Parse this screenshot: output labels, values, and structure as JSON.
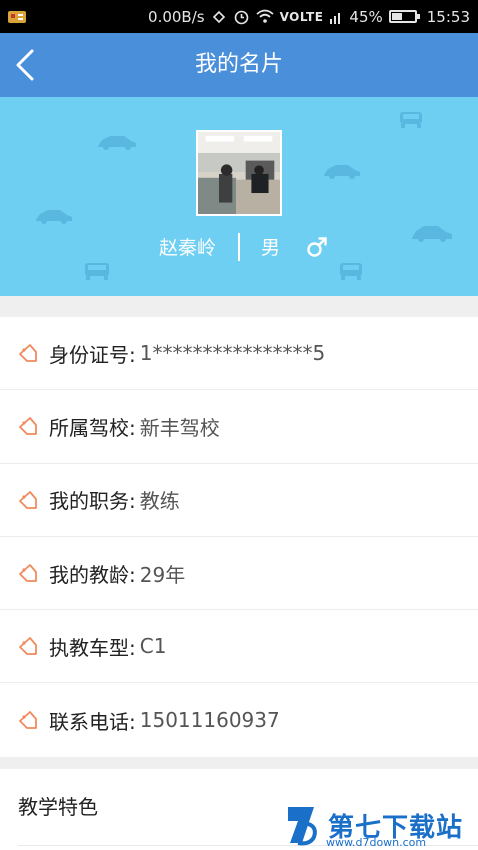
{
  "status_bar": {
    "network_speed": "0.00B/s",
    "volte": "VOLTE",
    "battery_percent": "45%",
    "battery_level": 0.45,
    "time": "15:53"
  },
  "nav": {
    "title": "我的名片"
  },
  "profile": {
    "name": "赵秦岭",
    "gender": "男"
  },
  "info": {
    "rows": [
      {
        "label": "身份证号:",
        "value": "1****************5"
      },
      {
        "label": "所属驾校:",
        "value": "新丰驾校"
      },
      {
        "label": "我的职务:",
        "value": "教练"
      },
      {
        "label": "我的教龄:",
        "value": "29年"
      },
      {
        "label": "执教车型:",
        "value": "C1"
      },
      {
        "label": "联系电话:",
        "value": "15011160937"
      }
    ]
  },
  "features": {
    "title": "教学特色"
  },
  "watermark": {
    "brand": "第七下载站",
    "url": "www.d7down.com"
  },
  "colors": {
    "nav": "#4a8fd9",
    "hero": "#6ecff2",
    "tag_icon": "#f08a5d"
  }
}
